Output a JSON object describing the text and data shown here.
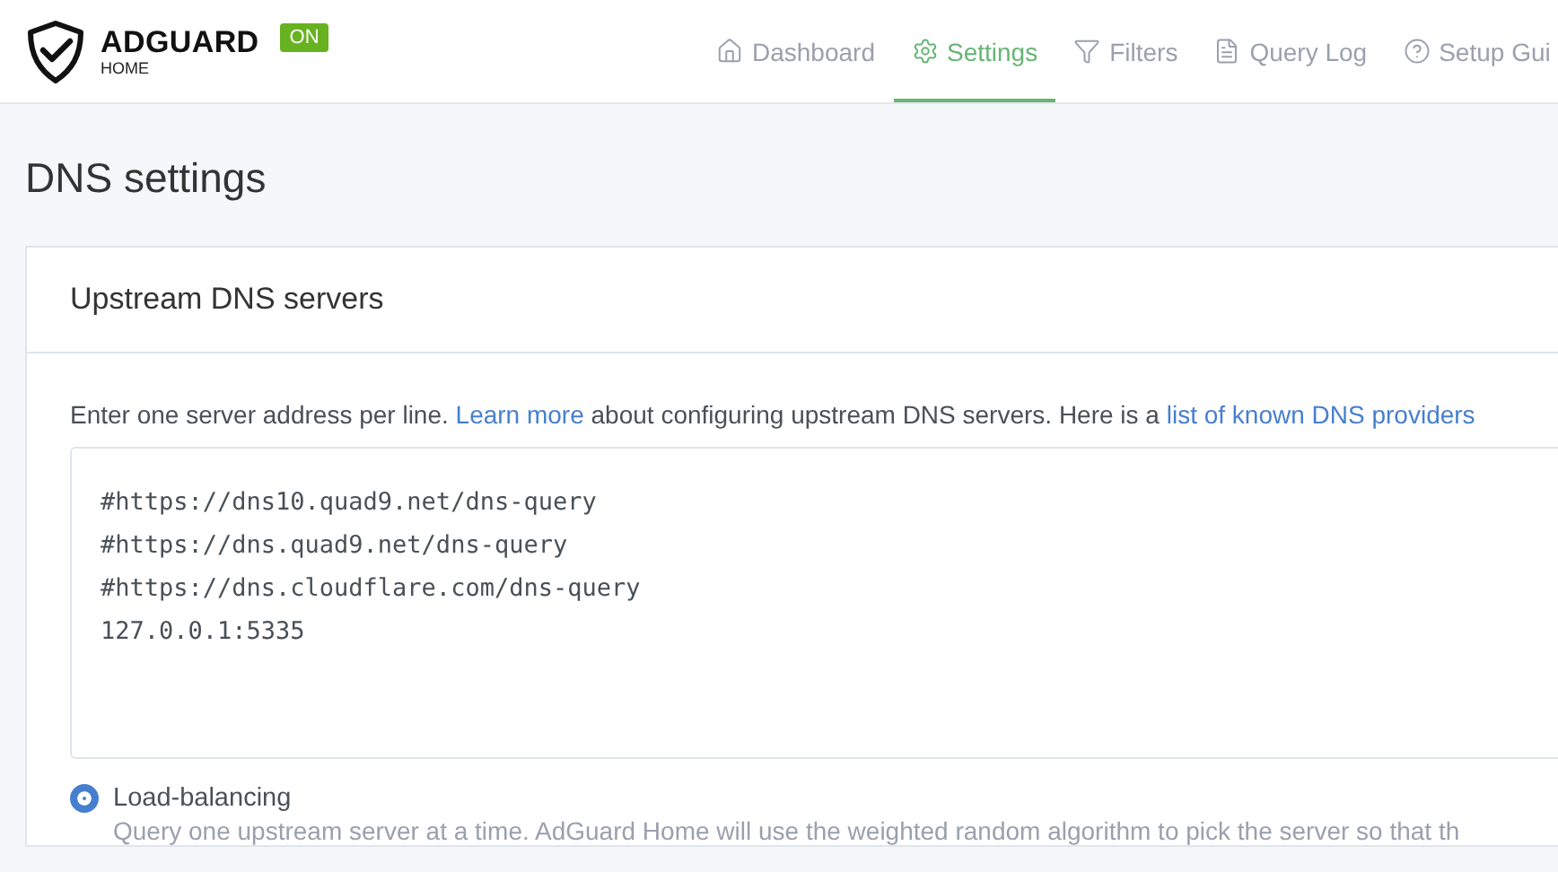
{
  "header": {
    "brand": "ADGUARD",
    "brand_sub": "HOME",
    "status_badge": "ON",
    "nav": [
      {
        "label": "Dashboard",
        "selected": false
      },
      {
        "label": "Settings",
        "selected": true
      },
      {
        "label": "Filters",
        "selected": false
      },
      {
        "label": "Query Log",
        "selected": false
      },
      {
        "label": "Setup Gui",
        "selected": false
      }
    ]
  },
  "page_title": "DNS settings",
  "card": {
    "title": "Upstream DNS servers",
    "help": [
      {
        "kind": "text",
        "text": "Enter one server address per line. "
      },
      {
        "kind": "link",
        "text": "Learn more"
      },
      {
        "kind": "text",
        "text": " about configuring upstream DNS servers. Here is a "
      },
      {
        "kind": "link",
        "text": "list of known DNS providers"
      }
    ],
    "upstreams": "#https://dns10.quad9.net/dns-query\n#https://dns.quad9.net/dns-query\n#https://dns.cloudflare.com/dns-query\n127.0.0.1:5335",
    "modes": [
      {
        "label": "Load-balancing",
        "selected": true,
        "description": "Query one upstream server at a time. AdGuard Home will use the weighted random algorithm to pick the server so that th"
      }
    ]
  }
}
